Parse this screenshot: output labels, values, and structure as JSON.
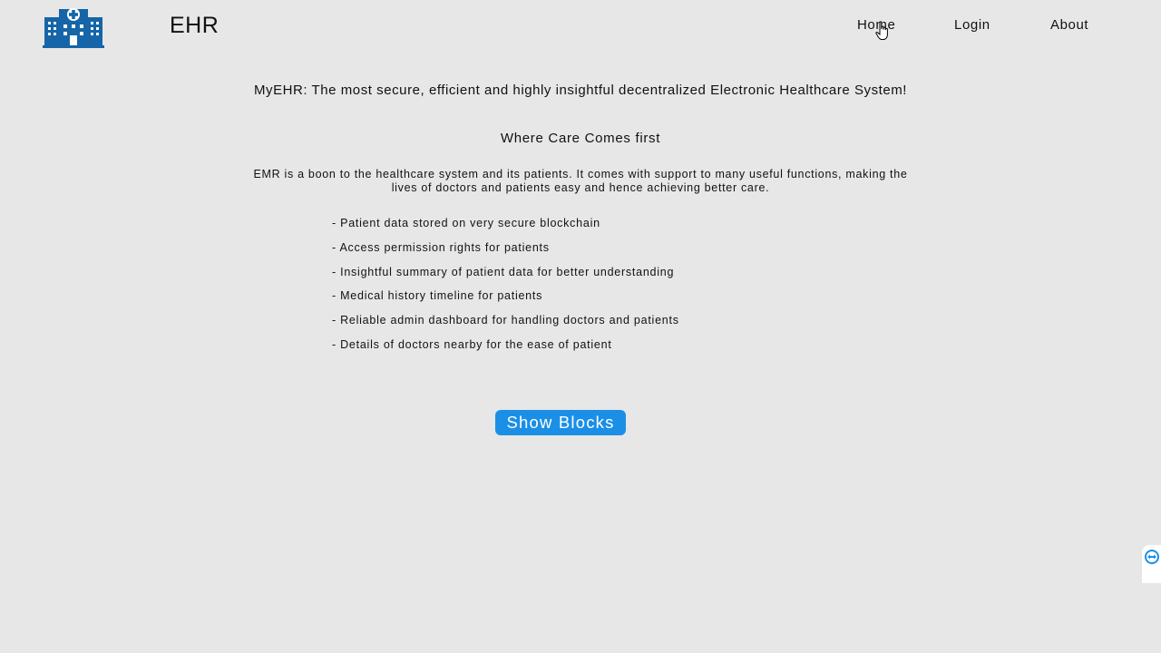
{
  "header": {
    "brand": "EHR",
    "nav": {
      "home": "Home",
      "login": "Login",
      "about": "About"
    },
    "logo_icon": "hospital-icon",
    "logo_color": "#1565a8"
  },
  "main": {
    "tagline": "MyEHR: The most secure, efficient and highly insightful decentralized Electronic Healthcare System!",
    "subtitle": "Where Care Comes first",
    "intro": "EMR is a boon to the healthcare system and its patients. It comes with support to many useful functions, making the lives of doctors and patients easy and hence achieving better care.",
    "features": [
      "- Patient data stored on very secure blockchain",
      "- Access permission rights for patients",
      "- Insightful summary of patient data for better understanding",
      "- Medical history timeline for patients",
      "- Reliable admin dashboard for handling doctors and patients",
      "- Details of doctors nearby for the ease of patient"
    ],
    "show_blocks_label": "Show Blocks",
    "button_color": "#1b8fe6"
  },
  "widget": {
    "icon": "remote-support-icon",
    "color": "#1b8fe6"
  }
}
